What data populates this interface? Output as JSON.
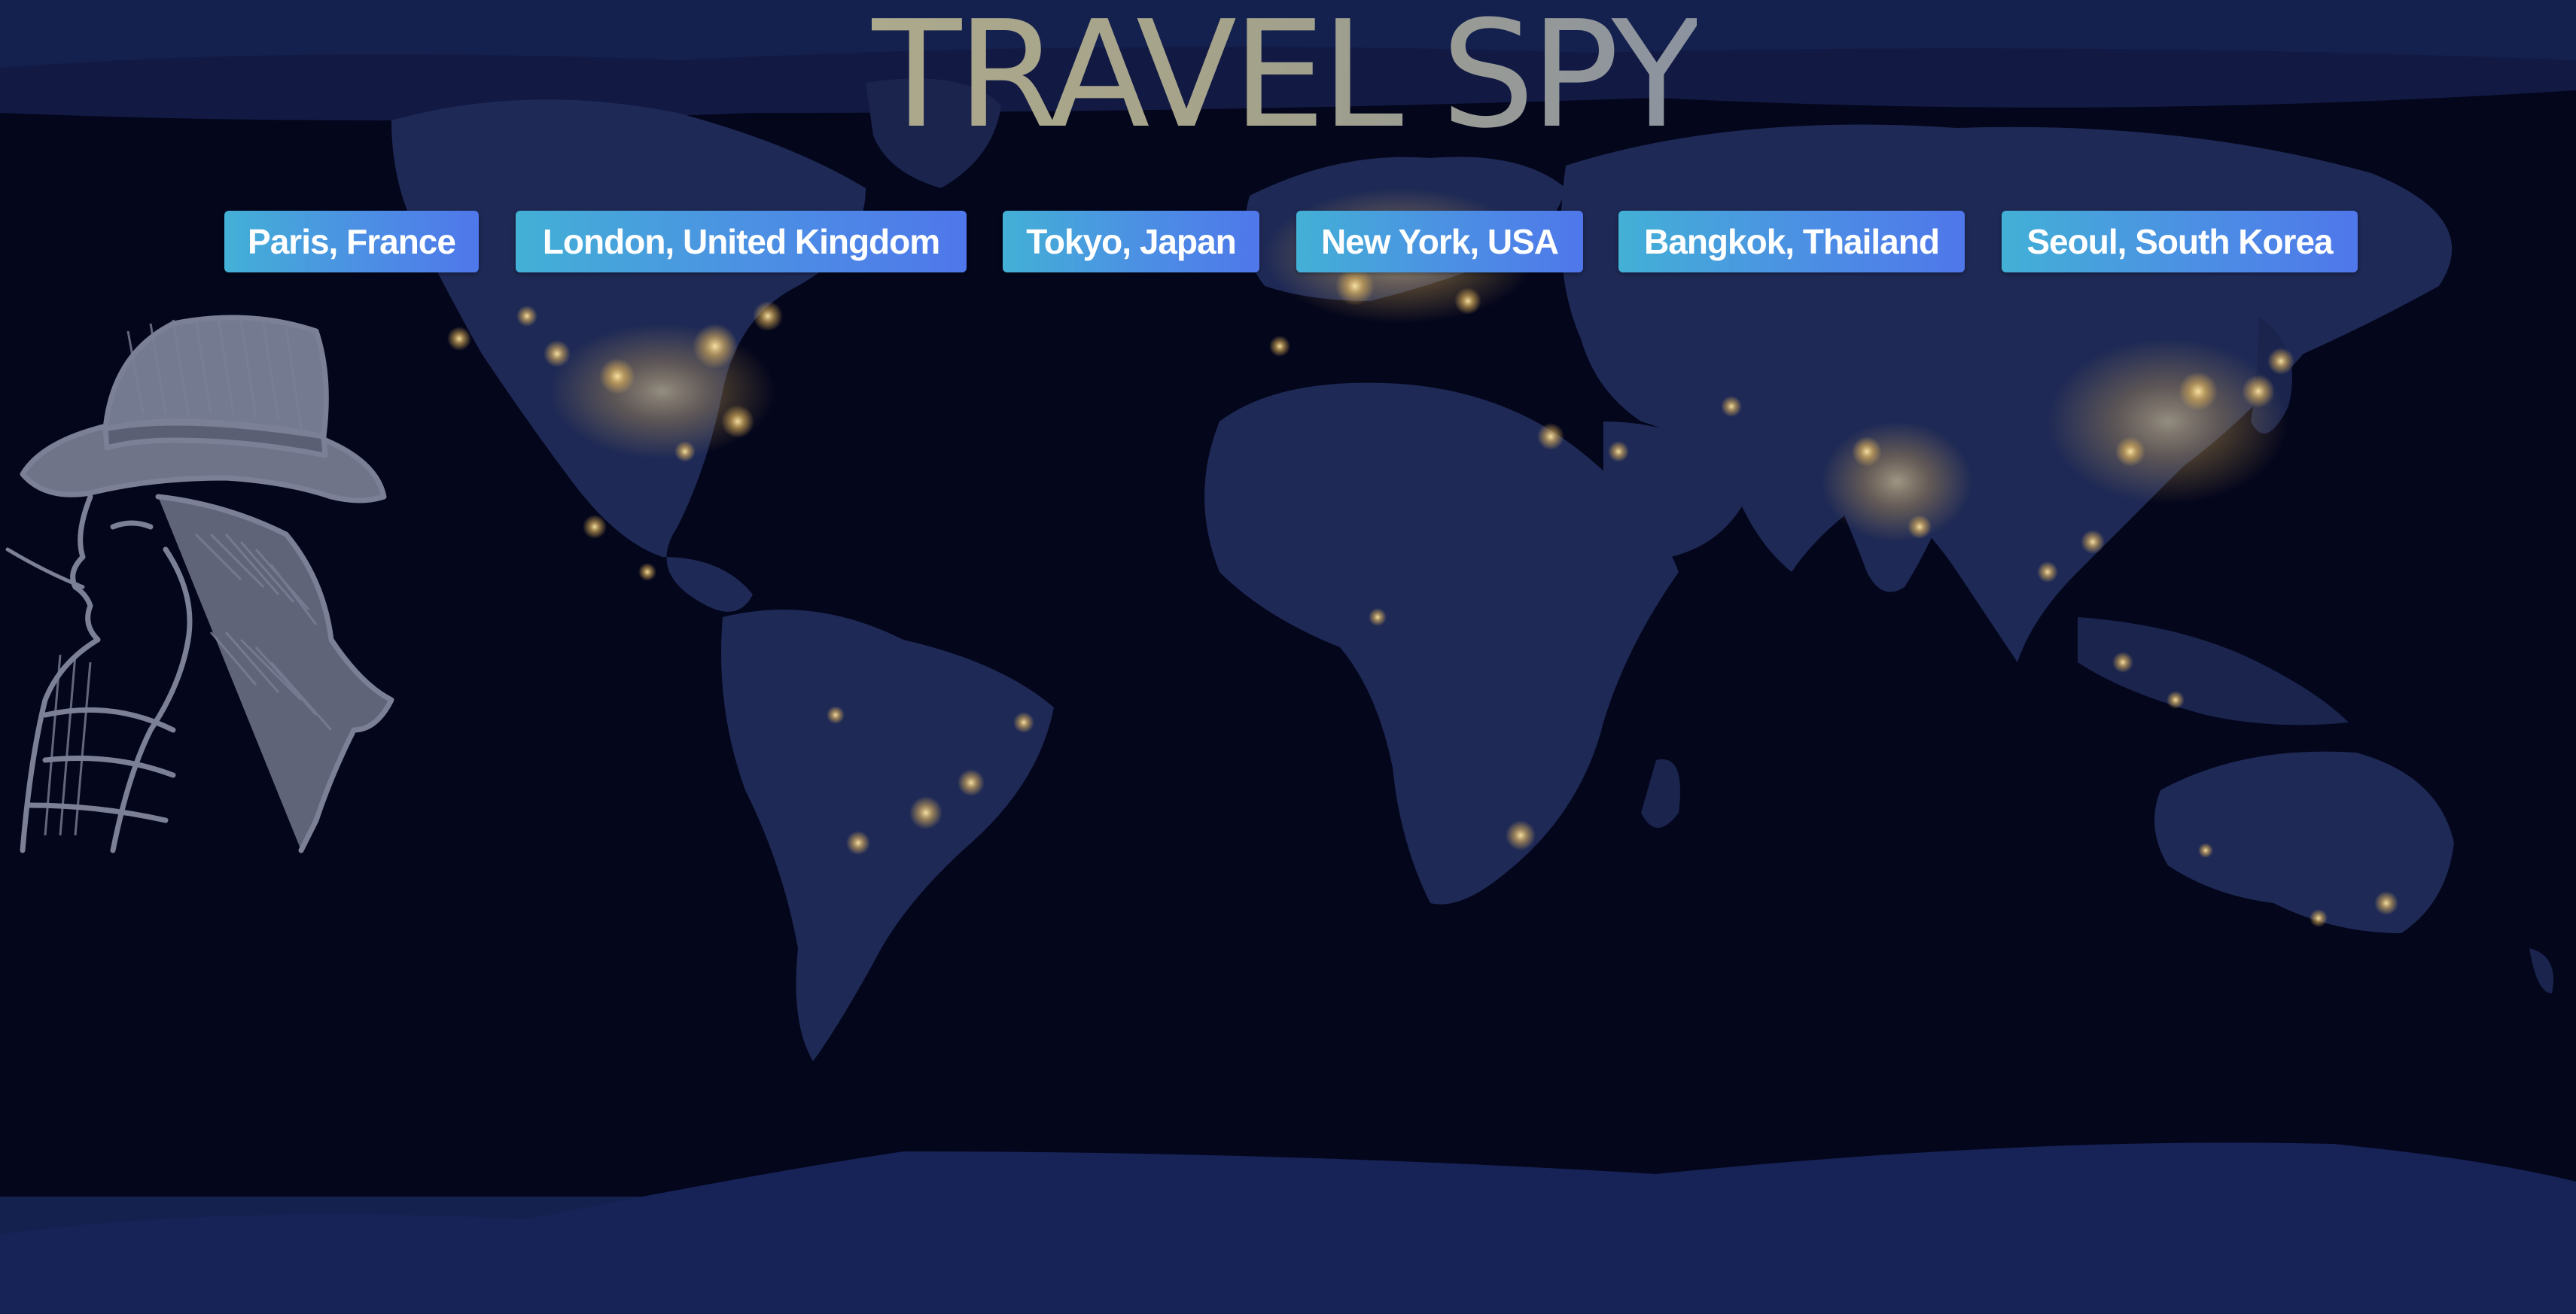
{
  "app": {
    "title": "TRAVEL SPY"
  },
  "destinations": [
    {
      "label": "Paris, France"
    },
    {
      "label": "London, United Kingdom"
    },
    {
      "label": "Tokyo, Japan"
    },
    {
      "label": "New York, USA"
    },
    {
      "label": "Bangkok, Thailand"
    },
    {
      "label": "Seoul, South Korea"
    }
  ],
  "icons": {
    "background": "world-night-map-icon",
    "mascot": "spy-illustration-icon"
  },
  "colors": {
    "background_top": "#14204d",
    "ocean": "#04061c",
    "land": "#1e2955",
    "city_lights": "#f6d27a",
    "button_start": "#43b0d6",
    "button_end": "#4f77ea",
    "button_text": "#ffffff",
    "title_gradient_start": "#aca98c",
    "title_gradient_end": "#8c93a0",
    "spy_line": "#7b8096"
  }
}
